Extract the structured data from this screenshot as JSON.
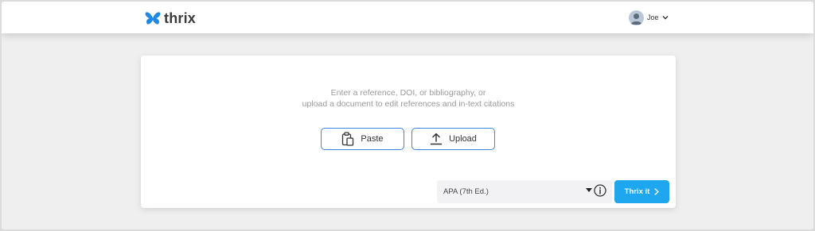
{
  "header": {
    "brand": "thrix",
    "user_name": "Joe",
    "icons": {
      "logo": "butterfly-icon",
      "avatar": "user-avatar-icon",
      "menu": "chevron-down-icon"
    },
    "colors": {
      "logo": "#1e88e5"
    }
  },
  "main": {
    "instruction_line1": "Enter a reference, DOI, or bibliography, or",
    "instruction_line2": "upload a document to edit references and in-text citations",
    "paste_label": "Paste",
    "upload_label": "Upload",
    "citation_style": "APA (7th Ed.)",
    "submit_label": "Thrix it",
    "icons": {
      "paste": "clipboard-icon",
      "upload": "upload-icon",
      "info": "info-icon",
      "submit": "chevron-right-icon",
      "select": "caret-down-icon"
    },
    "colors": {
      "accent": "#1ea7ef",
      "outline": "#3b86d6"
    }
  }
}
